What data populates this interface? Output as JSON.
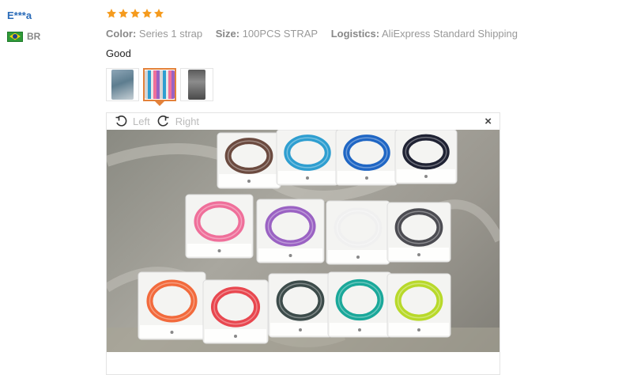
{
  "review": {
    "user": "E***a",
    "country": "BR",
    "rating": 5,
    "attributes": [
      {
        "key": "Color:",
        "value": "Series 1 strap"
      },
      {
        "key": "Size:",
        "value": "100PCS STRAP"
      },
      {
        "key": "Logistics:",
        "value": "AliExpress Standard Shipping"
      }
    ],
    "text": "Good"
  },
  "viewer": {
    "left_label": "Left",
    "right_label": "Right",
    "close_label": "×"
  },
  "colors": {
    "star": "#f59b1e",
    "user_link": "#2a6bb8",
    "active_thumb_border": "#e3813a"
  },
  "straps": [
    "#6b4a3f",
    "#2e9ed0",
    "#1f66c4",
    "#1f2233",
    "#ef6f9a",
    "#9a62c3",
    "#f0f0f0",
    "#4c4c52",
    "#f26a3c",
    "#e8474f",
    "#3c4b4a",
    "#1aa89a",
    "#b8d92a"
  ]
}
